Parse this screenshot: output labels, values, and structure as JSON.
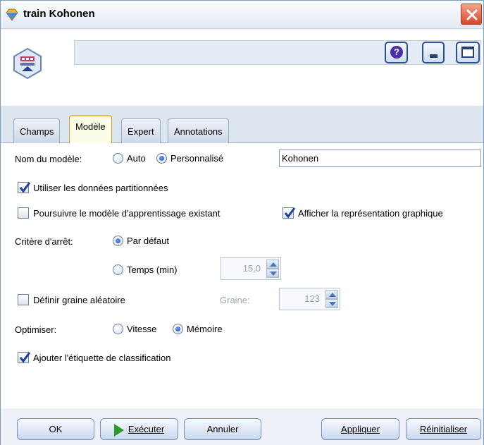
{
  "window": {
    "title": "train Kohonen"
  },
  "tabs": [
    {
      "label": "Champs"
    },
    {
      "label": "Modèle"
    },
    {
      "label": "Expert"
    },
    {
      "label": "Annotations"
    }
  ],
  "form": {
    "model_name_label": "Nom du modèle:",
    "auto_label": "Auto",
    "custom_label": "Personnalisé",
    "model_name_value": "Kohonen",
    "use_partitioned_label": "Utiliser les données partitionnées",
    "continue_training_label": "Poursuivre le modèle d'apprentissage existant",
    "show_graph_label": "Afficher la représentation graphique",
    "stop_criterion_label": "Critère d'arrêt:",
    "default_label": "Par défaut",
    "time_label": "Temps (min)",
    "time_value": "15,0",
    "random_seed_label": "Définir graine aléatoire",
    "seed_label": "Graine:",
    "seed_value": "123",
    "optimize_label": "Optimiser:",
    "speed_label": "Vitesse",
    "memory_label": "Mémoire",
    "add_cluster_label": "Ajouter l'étiquette de classification"
  },
  "footer": {
    "ok": "OK",
    "run": "Exécuter",
    "cancel": "Annuler",
    "apply": "Appliquer",
    "reset": "Réinitialiser"
  },
  "icons": {
    "app": "diamond-icon",
    "node": "kohonen-node-icon",
    "help": "help-icon",
    "minimize": "minimize-icon",
    "maximize": "maximize-icon",
    "close": "close-icon",
    "run": "play-icon"
  },
  "colors": {
    "accent": "#2a4f9a",
    "close": "#d8472a",
    "run": "#2b9a2b",
    "active_tab": "#e8b84a"
  }
}
